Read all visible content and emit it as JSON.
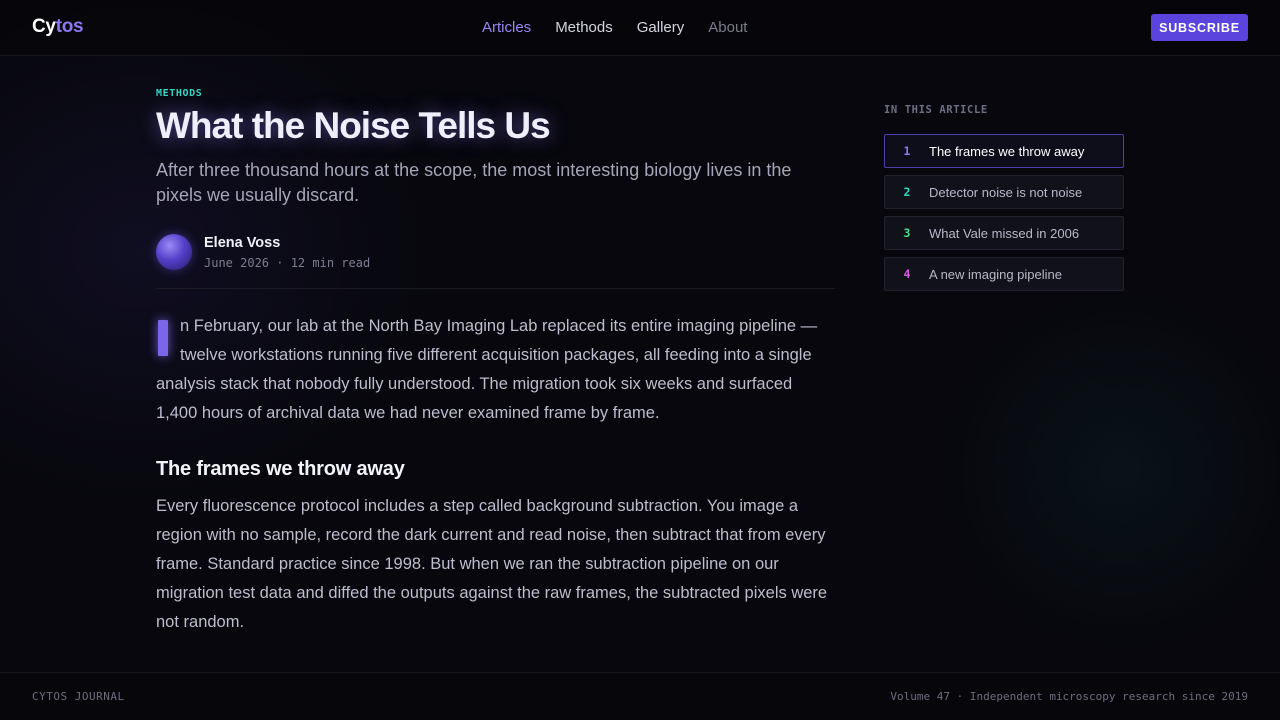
{
  "header": {
    "logo_part1": "Cy",
    "logo_part2": "tos",
    "nav": [
      {
        "label": "Articles"
      },
      {
        "label": "Methods"
      },
      {
        "label": "Gallery"
      },
      {
        "label": "About"
      }
    ],
    "subscribe_label": "SUBSCRIBE"
  },
  "article": {
    "kicker": "METHODS",
    "title": "What the Noise Tells Us",
    "subtitle": "After three thousand hours at the scope, the most interesting biology lives in the pixels we usually discard.",
    "author": "Elena Voss",
    "meta": "June 2026 · 12 min read",
    "lead": "n February, our lab at the North Bay Imaging Lab replaced its entire imaging pipeline — twelve workstations running five different acquisition packages, all feeding into a single analysis stack that nobody fully understood. The migration took six weeks and surfaced 1,400 hours of archival data we had never examined frame by frame.",
    "section_heading": "The frames we throw away",
    "paragraph2": "Every fluorescence protocol includes a step called background subtraction. You image a region with no sample, record the dark current and read noise, then subtract that from every frame. Standard practice since 1998. But when we ran the subtraction pipeline on our migration test data and diffed the outputs against the raw frames, the subtracted pixels were not random."
  },
  "toc": {
    "label": "IN THIS ARTICLE",
    "items": [
      {
        "num": "1",
        "text": "The frames we throw away",
        "color": "#8b78f0"
      },
      {
        "num": "2",
        "text": "Detector noise is not noise",
        "color": "#36d6c2"
      },
      {
        "num": "3",
        "text": "What Vale missed in 2006",
        "color": "#4be08a"
      },
      {
        "num": "4",
        "text": "A new imaging pipeline",
        "color": "#d65ae0"
      }
    ]
  },
  "footer": {
    "left": "CYTOS JOURNAL",
    "right": "Volume 47 · Independent microscopy research since 2019"
  },
  "colors": {
    "accent": "#5b44dd",
    "kicker": "#36d6c2",
    "background": "#07070d"
  }
}
